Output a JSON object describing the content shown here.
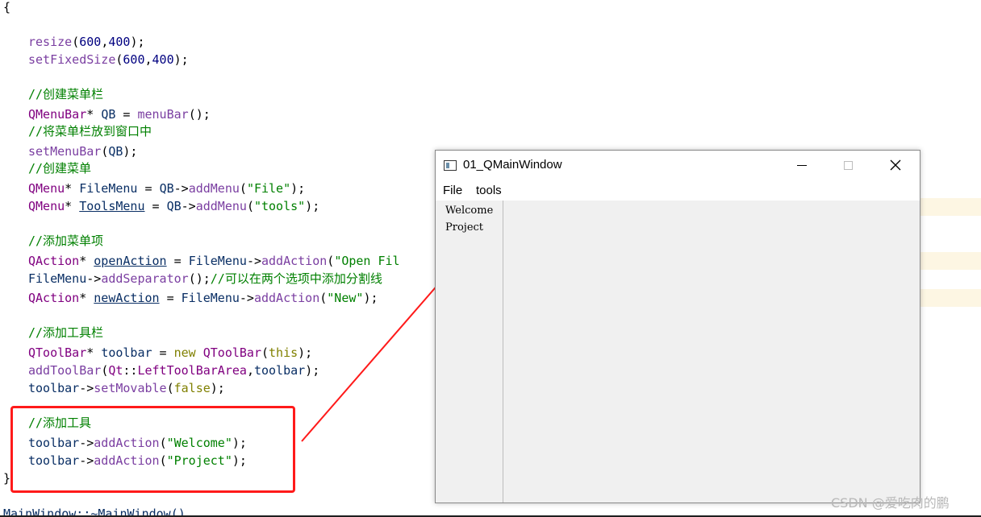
{
  "editor": {
    "top_brace": "{",
    "close_brace": "}",
    "cut_line": "MainWindow::~MainWindow()",
    "code": {
      "resize_fn": "resize",
      "resize_w": "600",
      "resize_h": "400",
      "fixed_fn": "setFixedSize",
      "fixed_w": "600",
      "fixed_h": "400",
      "c1": "//创建菜单栏",
      "qmenubar_type": "QMenuBar",
      "qb_var": "QB",
      "menubar_fn": "menuBar",
      "c2": "//将菜单栏放到窗口中",
      "setmenubar_fn": "setMenuBar",
      "c3": "//创建菜单",
      "qmenu_type": "QMenu",
      "filemenu_var": "FileMenu",
      "addmenu_fn": "addMenu",
      "file_str": "\"File\"",
      "toolsmenu_var": "ToolsMenu",
      "tools_str": "\"tools\"",
      "c4": "//添加菜单项",
      "qaction_type": "QAction",
      "openaction_var": "openAction",
      "addaction_fn": "addAction",
      "openfile_str": "\"Open Fil",
      "addseparator_fn": "addSeparator",
      "c5": "//可以在两个选项中添加分割线",
      "newaction_var": "newAction",
      "new_str": "\"New\"",
      "c6": "//添加工具栏",
      "qtoolbar_type": "QToolBar",
      "toolbar_var": "toolbar",
      "new_kw": "new",
      "this_kw": "this",
      "addtoolbar_fn": "addToolBar",
      "qt_ns": "Qt",
      "lefttoolbararea": "LeftToolBarArea",
      "setmovable_fn": "setMovable",
      "false_kw": "false",
      "c7": "//添加工具",
      "welcome_str": "\"Welcome\"",
      "project_str": "\"Project\""
    }
  },
  "qt_window": {
    "title": "01_QMainWindow",
    "menus": [
      "File",
      "tools"
    ],
    "toolbar_actions": [
      "Welcome",
      "Project"
    ]
  },
  "watermark": "CSDN @爱吃肉的鹏",
  "colors": {
    "annotation_red": "#ff1a1a",
    "comment_green": "#008000",
    "function_purple": "#7a3ea1",
    "type_purple": "#800080"
  }
}
